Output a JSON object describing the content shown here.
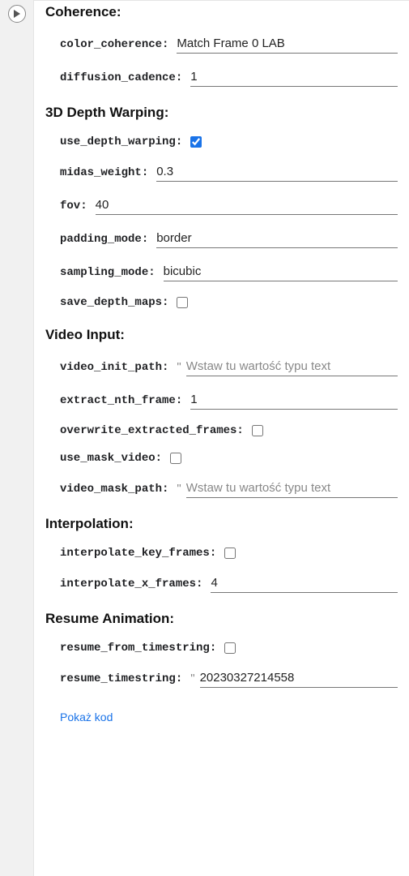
{
  "sections": {
    "coherence": {
      "title": "Coherence:",
      "color_coherence_label": "color_coherence:",
      "color_coherence_value": "Match Frame 0 LAB",
      "diffusion_cadence_label": "diffusion_cadence:",
      "diffusion_cadence_value": "1"
    },
    "depth": {
      "title": "3D Depth Warping:",
      "use_depth_warping_label": "use_depth_warping:",
      "use_depth_warping_checked": true,
      "midas_weight_label": "midas_weight:",
      "midas_weight_value": "0.3",
      "fov_label": "fov:",
      "fov_value": "40",
      "padding_mode_label": "padding_mode:",
      "padding_mode_value": "border",
      "sampling_mode_label": "sampling_mode:",
      "sampling_mode_value": "bicubic",
      "save_depth_maps_label": "save_depth_maps:",
      "save_depth_maps_checked": false
    },
    "video": {
      "title": "Video Input:",
      "video_init_path_label": "video_init_path:",
      "video_init_path_value": "",
      "video_init_path_placeholder": "Wstaw tu wartość typu text",
      "extract_nth_frame_label": "extract_nth_frame:",
      "extract_nth_frame_value": "1",
      "overwrite_extracted_frames_label": "overwrite_extracted_frames:",
      "overwrite_extracted_frames_checked": false,
      "use_mask_video_label": "use_mask_video:",
      "use_mask_video_checked": false,
      "video_mask_path_label": "video_mask_path:",
      "video_mask_path_value": "",
      "video_mask_path_placeholder": "Wstaw tu wartość typu text"
    },
    "interpolation": {
      "title": "Interpolation:",
      "interpolate_key_frames_label": "interpolate_key_frames:",
      "interpolate_key_frames_checked": false,
      "interpolate_x_frames_label": "interpolate_x_frames:",
      "interpolate_x_frames_value": "4"
    },
    "resume": {
      "title": "Resume Animation:",
      "resume_from_timestring_label": "resume_from_timestring:",
      "resume_from_timestring_checked": false,
      "resume_timestring_label": "resume_timestring:",
      "resume_timestring_value": "20230327214558"
    }
  },
  "show_code_label": "Pokaż kod"
}
